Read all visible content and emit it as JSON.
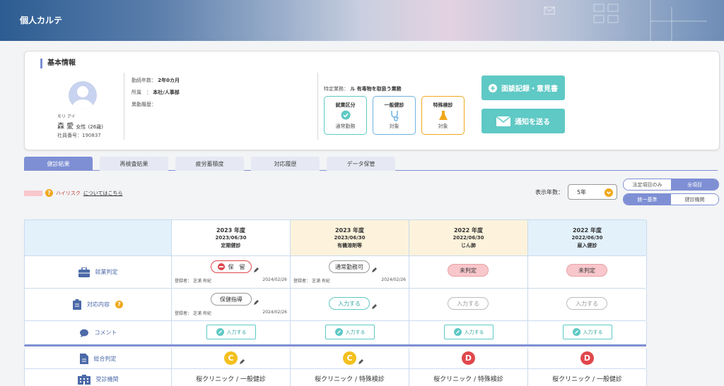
{
  "header": {
    "title": "個人カルテ"
  },
  "basic_info": {
    "section_title": "基本情報",
    "kana": "モリ アイ",
    "name": "森 愛",
    "gender": "女性",
    "age": "(26歳)",
    "employee_no_label": "社員番号：",
    "employee_no": "190837",
    "tenure_label": "勤続年数：",
    "tenure": "2年0カ月",
    "dept_label": "所属　：",
    "dept": "本社/人事部",
    "history_label": "異動履歴：",
    "ops_label": "特定業務：",
    "ops_value": "ル 有毒物を取扱う業務",
    "status_boxes": [
      {
        "title": "就業区分",
        "value": "通常勤務",
        "color": "#5fc9c5"
      },
      {
        "title": "一般健診",
        "value": "対象",
        "color": "#6fb3e0"
      },
      {
        "title": "特殊検診",
        "value": "対象",
        "color": "#f0a81c"
      }
    ],
    "buttons": {
      "interview": "面談記録・意見書",
      "notify": "通知を送る"
    }
  },
  "tabs": [
    "健診結果",
    "再検査結果",
    "疲労蓄積度",
    "対応履歴",
    "データ保管"
  ],
  "legend": {
    "label": "ハイリスク",
    "link": "についてはこちら"
  },
  "years": {
    "label": "表示年数：",
    "value": "5年"
  },
  "toggles": {
    "group1": [
      "法定項目のみ",
      "全項目"
    ],
    "group2": [
      "統一基準",
      "健診機関"
    ]
  },
  "table": {
    "columns": [
      {
        "year": "2023 年度",
        "date": "2023/06/30",
        "kind": "定期健診",
        "bg": "#ffffff"
      },
      {
        "year": "2023 年度",
        "date": "2023/06/30",
        "kind": "有機溶剤等",
        "bg": "#fdf3dc"
      },
      {
        "year": "2022 年度",
        "date": "2022/06/30",
        "kind": "じん肺",
        "bg": "#fdf3dc"
      },
      {
        "year": "2022 年度",
        "date": "2022/06/30",
        "kind": "雇入健診",
        "bg": "#e3f1fb"
      }
    ],
    "rows": {
      "employment": {
        "label": "就業判定"
      },
      "response": {
        "label": "対応内容"
      },
      "comment": {
        "label": "コメント"
      },
      "overall": {
        "label": "総合判定"
      },
      "clinic": {
        "label": "受診機関"
      }
    },
    "employment_values": [
      "保　留",
      "通常勤務可",
      "未判定",
      "未判定"
    ],
    "response_values": [
      "保健指導",
      "入力する",
      "入力する",
      "入力する"
    ],
    "registrant": "登録者：",
    "registrant_name": "芝浦 有紀",
    "reg_date": "2024/02/26",
    "comment_btn": "入力する",
    "grades": [
      "C",
      "C",
      "D",
      "D"
    ],
    "clinics": [
      "桜クリニック / 一般健診",
      "桜クリニック / 特殊検診",
      "桜クリニック / 特殊検診",
      "桜クリニック / 一般健診"
    ]
  },
  "colors": {
    "accent": "#7e8fd4",
    "teal": "#5fc9c5",
    "gradeC": "#f4c01e",
    "gradeD": "#e0474c"
  }
}
